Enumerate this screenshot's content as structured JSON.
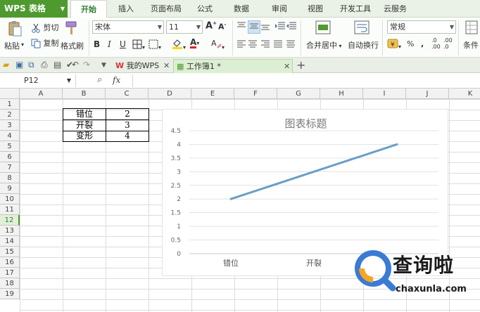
{
  "app": {
    "name": "WPS 表格"
  },
  "menu": {
    "tabs": [
      "开始",
      "插入",
      "页面布局",
      "公式",
      "数据",
      "审阅",
      "视图",
      "开发工具",
      "云服务"
    ]
  },
  "ribbon": {
    "paste": "粘贴",
    "cut": "剪切",
    "copy": "复制",
    "format_painter": "格式刷",
    "font_name": "宋体",
    "font_size": "11",
    "merge_center": "合并居中",
    "wrap_text": "自动换行",
    "number_format": "常规",
    "percent": "%",
    "comma": ",",
    "conditional": "条件"
  },
  "doc_tabs": [
    {
      "label": "我的WPS",
      "active": false
    },
    {
      "label": "工作簿1 *",
      "active": true
    }
  ],
  "formula_bar": {
    "name_box": "P12",
    "fx": "fx"
  },
  "grid": {
    "columns": [
      "A",
      "B",
      "C",
      "D",
      "E",
      "F",
      "G",
      "H",
      "I",
      "J",
      "K"
    ],
    "rows": [
      "1",
      "2",
      "3",
      "4",
      "5",
      "6",
      "7",
      "8",
      "9",
      "10",
      "11",
      "12",
      "13",
      "14",
      "15",
      "16",
      "17",
      "18",
      "19"
    ],
    "selected_row": "12",
    "table": [
      {
        "label": "错位",
        "value": "2"
      },
      {
        "label": "开裂",
        "value": "3"
      },
      {
        "label": "变形",
        "value": "4"
      }
    ]
  },
  "chart_data": {
    "type": "line",
    "title": "图表标题",
    "categories": [
      "错位",
      "开裂",
      "变形"
    ],
    "visible_categories": [
      "错位",
      "开裂"
    ],
    "series": [
      {
        "values": [
          2,
          3,
          4
        ],
        "color": "#6a9ec6"
      }
    ],
    "ylim": [
      0,
      4.5
    ],
    "yticks": [
      "0",
      "0.5",
      "1",
      "1.5",
      "2",
      "2.5",
      "3",
      "3.5",
      "4",
      "4.5"
    ],
    "grid": true
  },
  "watermark": {
    "title": "查询啦",
    "sub": "chaxunla.com"
  }
}
